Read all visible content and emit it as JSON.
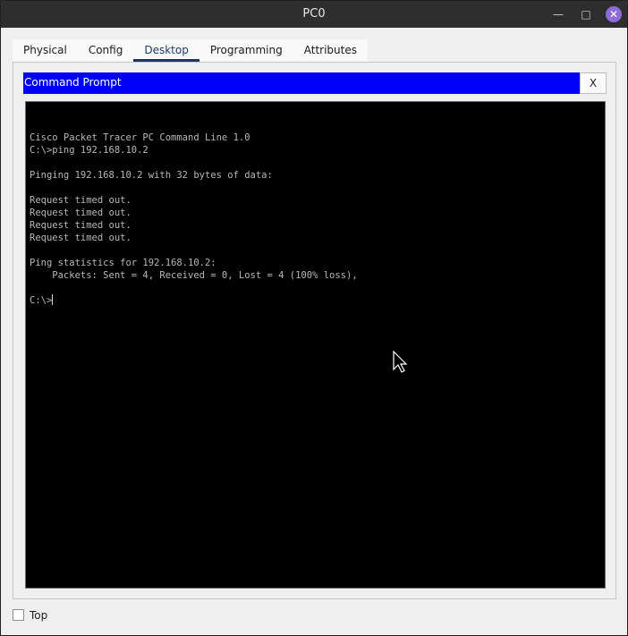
{
  "window": {
    "title": "PC0",
    "minimize_glyph": "—",
    "maximize_glyph": "□",
    "close_glyph": "✕"
  },
  "tabs": [
    {
      "label": "Physical"
    },
    {
      "label": "Config"
    },
    {
      "label": "Desktop",
      "active": true
    },
    {
      "label": "Programming"
    },
    {
      "label": "Attributes"
    }
  ],
  "command_prompt": {
    "title": "Command Prompt",
    "close_label": "X",
    "lines": [
      "",
      "Cisco Packet Tracer PC Command Line 1.0",
      "C:\\>ping 192.168.10.2",
      "",
      "Pinging 192.168.10.2 with 32 bytes of data:",
      "",
      "Request timed out.",
      "Request timed out.",
      "Request timed out.",
      "Request timed out.",
      "",
      "Ping statistics for 192.168.10.2:",
      "    Packets: Sent = 4, Received = 0, Lost = 4 (100% loss),",
      "",
      "C:\\>"
    ]
  },
  "footer": {
    "top_checkbox_label": "Top",
    "top_checked": false
  },
  "colors": {
    "cmd_header": "#0000fb",
    "terminal_bg": "#000000",
    "terminal_text": "#b8b8b8",
    "close_button": "#8f6bd6"
  }
}
